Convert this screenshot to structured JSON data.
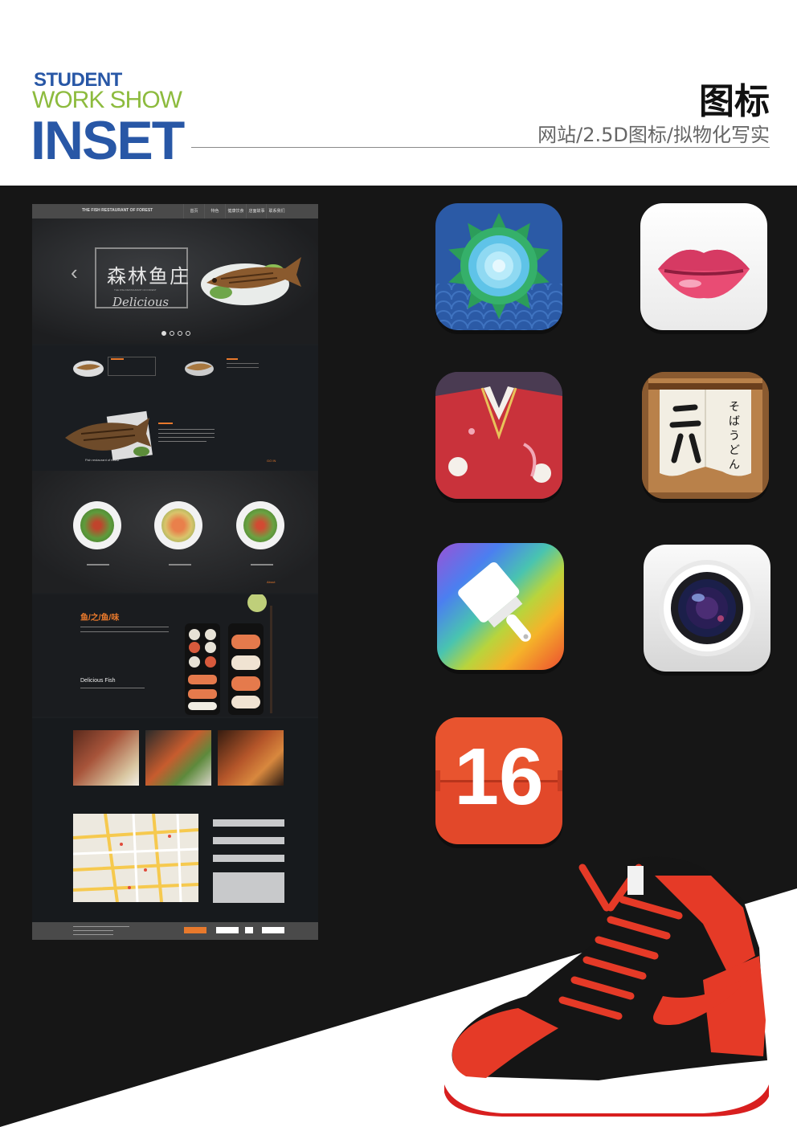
{
  "header": {
    "brand_line1": "STUDENT",
    "brand_line2": "WORK SHOW",
    "brand_line3": "INSET",
    "title": "图标",
    "subtitle": "网站/2.5D图标/拟物化写实"
  },
  "colors": {
    "brand_blue": "#2857a6",
    "brand_green": "#8dbb3e",
    "dark_background": "#161616",
    "mockup_background": "#1c1f22",
    "accent_orange": "#e8792c"
  },
  "mockup": {
    "nav_title": "THE FISH RESTAURANT OF FOREST",
    "nav_items": [
      "首页",
      "特色",
      "健康饮食",
      "店面故事",
      "联系我们"
    ],
    "logo_main": "森林鱼庄",
    "logo_sub": "THE FISH RESTAURANT OF FOREST",
    "hero_tagline": "Delicious",
    "carousel_prev": "‹",
    "feature_caption": "Fish restaurant of forest",
    "go_in": "GO IN",
    "about": "About",
    "fish_title": "鱼/之/鱼/味",
    "fish_heading": "Delicious Fish"
  },
  "icons": [
    "lotus-icon",
    "lips-icon",
    "kimono-icon",
    "noren-icon",
    "paint-brush-icon",
    "camera-icon",
    "calendar-icon"
  ],
  "calendar_day": "16"
}
